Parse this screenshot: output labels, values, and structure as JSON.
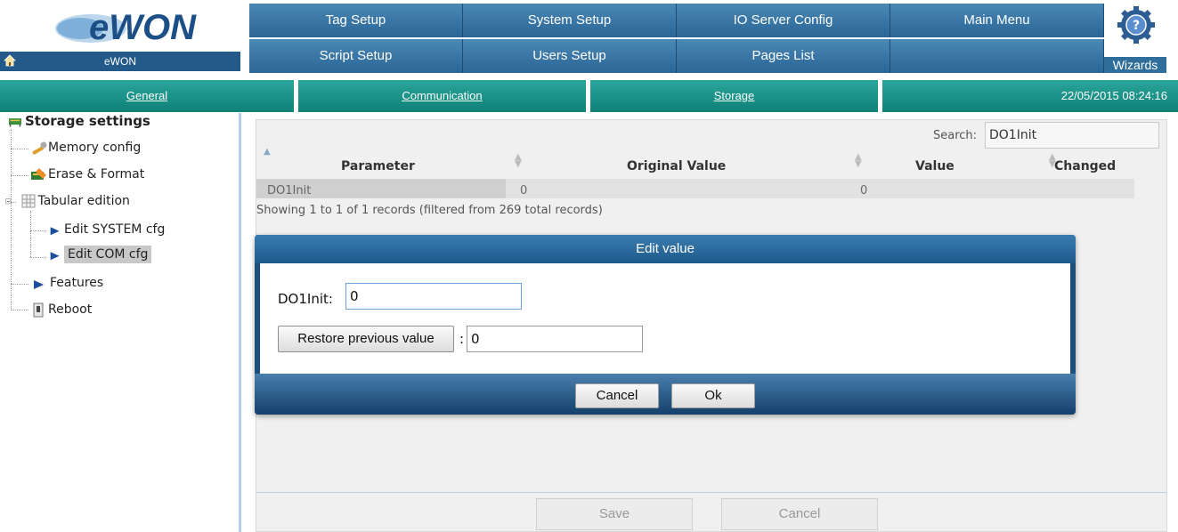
{
  "header": {
    "logo_text": "eWON",
    "device_name": "eWON",
    "nav_row1": [
      "Tag Setup",
      "System Setup",
      "IO Server Config",
      "Main Menu"
    ],
    "nav_row2": [
      "Script Setup",
      "Users Setup",
      "Pages List",
      ""
    ],
    "wizards_label": "Wizards"
  },
  "subtabs": {
    "general": "General",
    "communication": "Communication",
    "storage": "Storage",
    "datetime": "22/05/2015 08:24:16"
  },
  "sidebar": {
    "title": "Storage settings",
    "memory_config": "Memory config",
    "erase_format": "Erase & Format",
    "tabular_edition": "Tabular edition",
    "edit_system_cfg": "Edit SYSTEM cfg",
    "edit_com_cfg": "Edit COM cfg",
    "features": "Features",
    "reboot": "Reboot"
  },
  "table": {
    "search_label": "Search:",
    "search_value": "DO1Init",
    "headers": {
      "parameter": "Parameter",
      "original_value": "Original Value",
      "value": "Value",
      "changed": "Changed"
    },
    "rows": [
      {
        "parameter": "DO1Init",
        "original_value": "0",
        "value": "0",
        "changed": ""
      }
    ],
    "records_info": "Showing 1 to 1 of 1 records (filtered from 269 total records)"
  },
  "page_buttons": {
    "save": "Save",
    "cancel": "Cancel"
  },
  "modal": {
    "title": "Edit value",
    "field_label": "DO1Init:",
    "field_value": "0",
    "restore_label": "Restore previous value",
    "restore_sep": ":",
    "restore_value": "0",
    "cancel": "Cancel",
    "ok": "Ok"
  },
  "colors": {
    "nav_blue": "#2b6696",
    "tab_teal": "#0e8077",
    "modal_blue": "#1e4f7c"
  }
}
